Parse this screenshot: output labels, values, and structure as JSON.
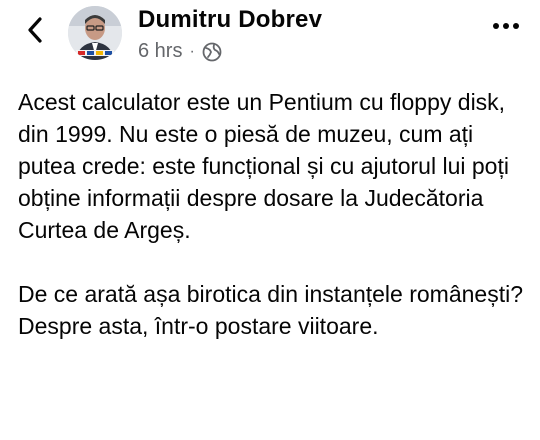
{
  "post": {
    "author": "Dumitru Dobrev",
    "time": "6 hrs",
    "separator": "·",
    "privacy_icon": "globe-icon",
    "paragraph1": "Acest calculator este un Pentium cu floppy disk, din 1999. Nu este o piesă de muzeu, cum ați putea crede: este funcțional și cu ajutorul lui poți obține informații despre dosare la Judecătoria Curtea de Argeș.",
    "paragraph2": "De ce arată așa birotica din instanțele românești? Despre asta, într-o postare viitoare."
  },
  "icons": {
    "back": "chevron-left-icon",
    "more": "more-options-icon"
  },
  "colors": {
    "text": "#050505",
    "secondary": "#65676b"
  }
}
